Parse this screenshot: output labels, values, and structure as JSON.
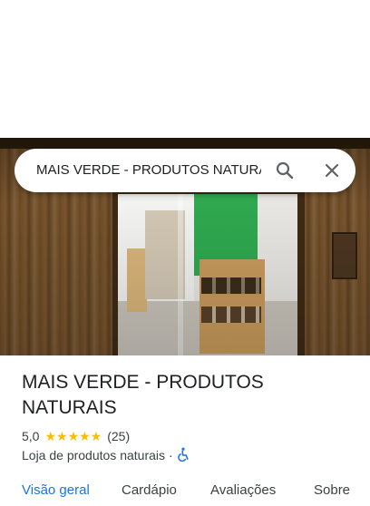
{
  "search": {
    "query": "MAIS VERDE - PRODUTOS NATURAI",
    "search_icon": "search-icon",
    "close_icon": "close-icon"
  },
  "place": {
    "title": "MAIS VERDE - PRODUTOS NATURAIS",
    "rating": "5,0",
    "stars": "★★★★★",
    "review_count": "(25)",
    "category": "Loja de produtos naturais",
    "separator": "·",
    "accessibility_icon": "wheelchair-icon"
  },
  "tabs": [
    {
      "label": "Visão geral",
      "active": true
    },
    {
      "label": "Cardápio",
      "active": false
    },
    {
      "label": "Avaliações",
      "active": false
    },
    {
      "label": "Sobre",
      "active": false
    }
  ],
  "colors": {
    "accent": "#1a73e8",
    "star": "#fbbc04",
    "text": "#202124"
  }
}
